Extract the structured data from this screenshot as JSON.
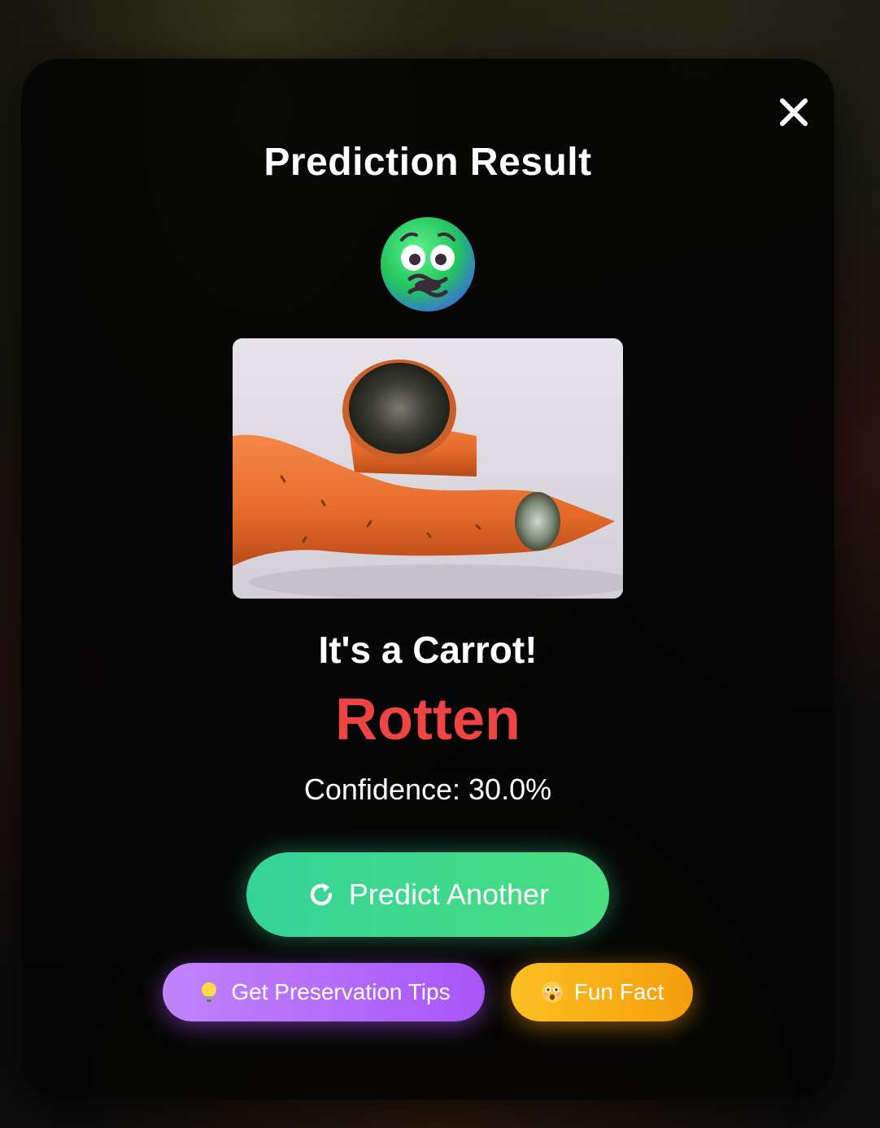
{
  "modal": {
    "title": "Prediction Result",
    "close_icon": "close-icon",
    "status_emoji": "nauseated-face-icon",
    "image_alt_subject": "rotten-carrot-photo",
    "item_label": "It's a Carrot!",
    "status_label": "Rotten",
    "status_color": "#ef4444",
    "confidence_text": "Confidence: 30.0%"
  },
  "actions": {
    "predict_another": {
      "label": "Predict Another",
      "icon": "refresh-icon",
      "color": "#34d399"
    },
    "preservation_tips": {
      "label": "Get Preservation Tips",
      "icon": "lightbulb-icon",
      "color": "#a855f7"
    },
    "fun_fact": {
      "label": "Fun Fact",
      "icon": "astonished-face-icon",
      "color": "#fbbf24"
    }
  }
}
